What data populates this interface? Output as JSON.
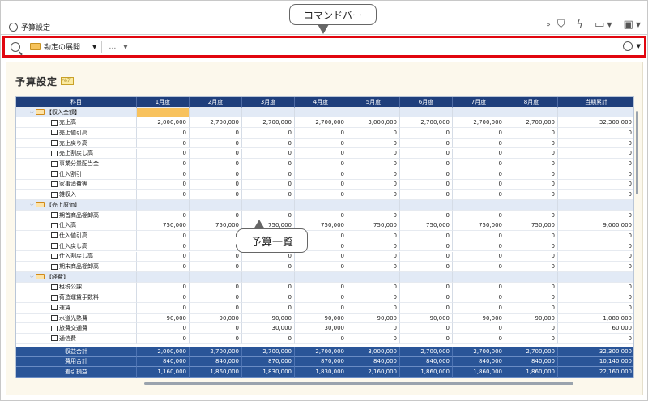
{
  "tab": {
    "label": "予算設定"
  },
  "toolbar": {
    "overflow": "»"
  },
  "callouts": {
    "command_bar": "コマンドバー",
    "budget_list": "予算一覧"
  },
  "command_bar": {
    "expand_label": "勘定の展開",
    "more_label": "…"
  },
  "page": {
    "title": "予算設定",
    "help_badge": "ﾍﾙﾌﾟ"
  },
  "grid": {
    "columns": [
      "科目",
      "1月度",
      "2月度",
      "3月度",
      "4月度",
      "5月度",
      "6月度",
      "7月度",
      "8月度",
      "当期累計"
    ],
    "rows": [
      {
        "type": "group",
        "label": "【収入金額】",
        "values": [
          "",
          "",
          "",
          "",
          "",
          "",
          "",
          "",
          ""
        ]
      },
      {
        "type": "item",
        "label": "売上高",
        "values": [
          "2,000,000",
          "2,700,000",
          "2,700,000",
          "2,700,000",
          "3,000,000",
          "2,700,000",
          "2,700,000",
          "2,700,000",
          "32,300,000"
        ]
      },
      {
        "type": "item",
        "label": "売上値引高",
        "values": [
          "0",
          "0",
          "0",
          "0",
          "0",
          "0",
          "0",
          "0",
          "0"
        ]
      },
      {
        "type": "item",
        "label": "売上戻り高",
        "values": [
          "0",
          "0",
          "0",
          "0",
          "0",
          "0",
          "0",
          "0",
          "0"
        ]
      },
      {
        "type": "item",
        "label": "売上割戻し高",
        "values": [
          "0",
          "0",
          "0",
          "0",
          "0",
          "0",
          "0",
          "0",
          "0"
        ]
      },
      {
        "type": "item",
        "label": "事業分量配当金",
        "values": [
          "0",
          "0",
          "0",
          "0",
          "0",
          "0",
          "0",
          "0",
          "0"
        ]
      },
      {
        "type": "item",
        "label": "仕入割引",
        "values": [
          "0",
          "0",
          "0",
          "0",
          "0",
          "0",
          "0",
          "0",
          "0"
        ]
      },
      {
        "type": "item",
        "label": "家事消費等",
        "values": [
          "0",
          "0",
          "0",
          "0",
          "0",
          "0",
          "0",
          "0",
          "0"
        ]
      },
      {
        "type": "item",
        "label": "雑収入",
        "values": [
          "0",
          "0",
          "0",
          "0",
          "0",
          "0",
          "0",
          "0",
          "0"
        ]
      },
      {
        "type": "group",
        "label": "【売上原価】",
        "values": [
          "",
          "",
          "",
          "",
          "",
          "",
          "",
          "",
          ""
        ]
      },
      {
        "type": "item",
        "label": "期首商品棚卸高",
        "values": [
          "0",
          "0",
          "0",
          "0",
          "0",
          "0",
          "0",
          "0",
          "0"
        ]
      },
      {
        "type": "item",
        "label": "仕入高",
        "values": [
          "750,000",
          "750,000",
          "750,000",
          "750,000",
          "750,000",
          "750,000",
          "750,000",
          "750,000",
          "9,000,000"
        ]
      },
      {
        "type": "item",
        "label": "仕入値引高",
        "values": [
          "0",
          "0",
          "0",
          "0",
          "0",
          "0",
          "0",
          "0",
          "0"
        ]
      },
      {
        "type": "item",
        "label": "仕入戻し高",
        "values": [
          "0",
          "0",
          "0",
          "0",
          "0",
          "0",
          "0",
          "0",
          "0"
        ]
      },
      {
        "type": "item",
        "label": "仕入割戻し高",
        "values": [
          "0",
          "0",
          "0",
          "0",
          "0",
          "0",
          "0",
          "0",
          "0"
        ]
      },
      {
        "type": "item",
        "label": "期末商品棚卸高",
        "values": [
          "0",
          "0",
          "0",
          "0",
          "0",
          "0",
          "0",
          "0",
          "0"
        ]
      },
      {
        "type": "group",
        "label": "【経費】",
        "values": [
          "",
          "",
          "",
          "",
          "",
          "",
          "",
          "",
          ""
        ]
      },
      {
        "type": "item",
        "label": "租税公課",
        "values": [
          "0",
          "0",
          "0",
          "0",
          "0",
          "0",
          "0",
          "0",
          "0"
        ]
      },
      {
        "type": "item",
        "label": "荷造運賃手数料",
        "values": [
          "0",
          "0",
          "0",
          "0",
          "0",
          "0",
          "0",
          "0",
          "0"
        ]
      },
      {
        "type": "item",
        "label": "運賃",
        "values": [
          "0",
          "0",
          "0",
          "0",
          "0",
          "0",
          "0",
          "0",
          "0"
        ]
      },
      {
        "type": "item",
        "label": "水道光熱費",
        "values": [
          "90,000",
          "90,000",
          "90,000",
          "90,000",
          "90,000",
          "90,000",
          "90,000",
          "90,000",
          "1,080,000"
        ]
      },
      {
        "type": "item",
        "label": "旅費交通費",
        "values": [
          "0",
          "0",
          "30,000",
          "30,000",
          "0",
          "0",
          "0",
          "0",
          "60,000"
        ]
      },
      {
        "type": "item",
        "label": "通信費",
        "values": [
          "0",
          "0",
          "0",
          "0",
          "0",
          "0",
          "0",
          "0",
          "0"
        ]
      }
    ],
    "totals": [
      {
        "label": "収益合計",
        "values": [
          "2,000,000",
          "2,700,000",
          "2,700,000",
          "2,700,000",
          "3,000,000",
          "2,700,000",
          "2,700,000",
          "2,700,000",
          "32,300,000"
        ]
      },
      {
        "label": "費用合計",
        "values": [
          "840,000",
          "840,000",
          "870,000",
          "870,000",
          "840,000",
          "840,000",
          "840,000",
          "840,000",
          "10,140,000"
        ]
      },
      {
        "label": "差引損益",
        "values": [
          "1,160,000",
          "1,860,000",
          "1,830,000",
          "1,830,000",
          "2,160,000",
          "1,860,000",
          "1,860,000",
          "1,860,000",
          "22,160,000"
        ]
      }
    ]
  },
  "colors": {
    "highlight": "#e1060f",
    "header": "#1f3f7c",
    "totals": "#2a5598",
    "selected_cell": "#f8c25d"
  }
}
